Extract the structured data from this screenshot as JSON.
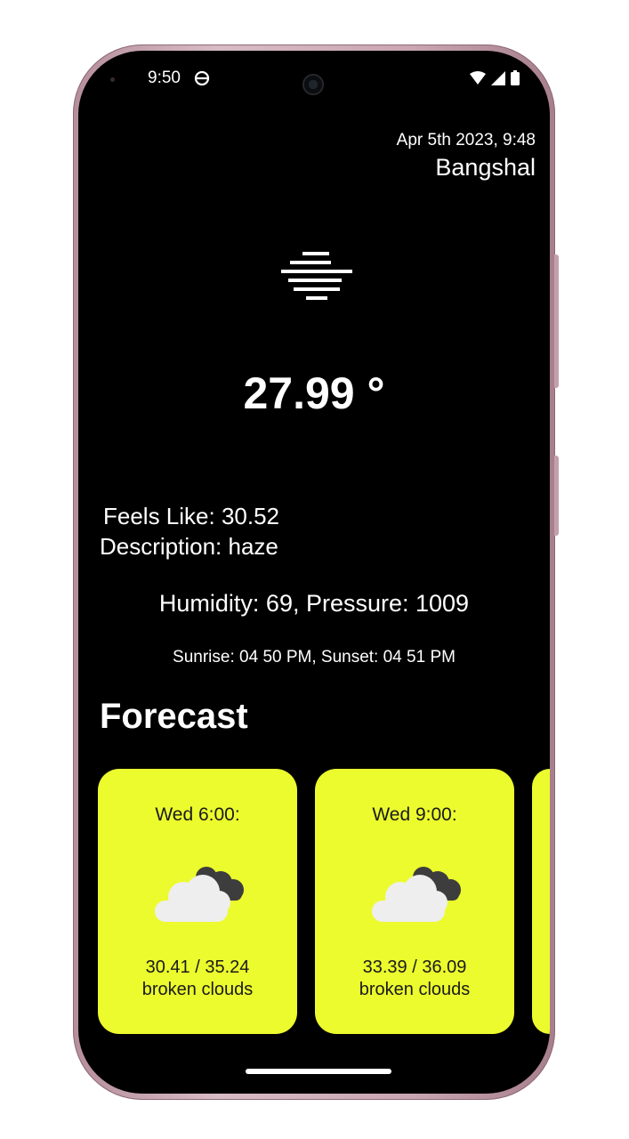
{
  "status_bar": {
    "time": "9:50"
  },
  "header": {
    "date_time": "Apr 5th 2023, 9:48",
    "location": "Bangshal"
  },
  "current": {
    "icon": "haze-icon",
    "temperature": "27.99 °",
    "feels_like": "Feels Like: 30.52",
    "description": "Description: haze",
    "humidity_pressure": "Humidity: 69, Pressure: 1009",
    "sunrise_sunset": "Sunrise: 04 50 PM, Sunset: 04 51 PM"
  },
  "forecast": {
    "title": "Forecast",
    "cards": [
      {
        "time": "Wed 6:00:",
        "temps": "30.41 / 35.24",
        "description": "broken clouds",
        "icon": "broken-clouds-icon"
      },
      {
        "time": "Wed 9:00:",
        "temps": "33.39 / 36.09",
        "description": "broken clouds",
        "icon": "broken-clouds-icon"
      }
    ]
  },
  "colors": {
    "background": "#000000",
    "card": "#ecfb2d",
    "text": "#ffffff",
    "phone_frame": "#c9a6b2"
  }
}
